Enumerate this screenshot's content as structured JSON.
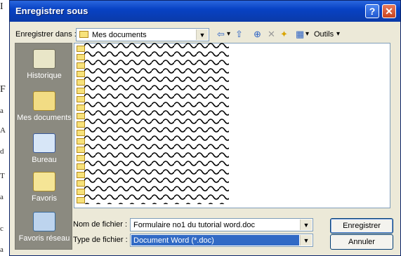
{
  "window": {
    "title": "Enregistrer sous",
    "help_glyph": "?",
    "close_glyph": "✕"
  },
  "lookin": {
    "label": "Enregistrer dans :",
    "value": "Mes documents",
    "arrow": "▼"
  },
  "toolbar": {
    "back": "⇦",
    "back_arrow": "▾",
    "up": "⇧",
    "search": "⊕",
    "delete": "✕",
    "new_folder": "✦",
    "views": "▦",
    "views_arrow": "▾",
    "tools_label": "Outils",
    "tools_arrow": "▾"
  },
  "places": [
    {
      "label": "Historique",
      "icon": "history-icon"
    },
    {
      "label": "Mes documents",
      "icon": "documents-folder-icon"
    },
    {
      "label": "Bureau",
      "icon": "desktop-icon"
    },
    {
      "label": "Favoris",
      "icon": "favorites-icon"
    },
    {
      "label": "Favoris réseau",
      "icon": "network-icon"
    }
  ],
  "files": [
    "",
    "",
    "",
    "",
    "",
    "",
    "",
    "",
    "",
    "",
    "",
    "",
    "",
    "",
    "",
    "",
    "",
    "",
    ""
  ],
  "filename": {
    "label": "Nom de fichier :",
    "value": "Formulaire no1 du tutorial word.doc"
  },
  "filetype": {
    "label": "Type de fichier :",
    "value": "Document Word (*.doc)"
  },
  "buttons": {
    "save": "Enregistrer",
    "cancel": "Annuler"
  },
  "background_letters": [
    "I",
    "F",
    "a",
    "A",
    "d",
    "T",
    "a",
    "c",
    "a"
  ],
  "colors": {
    "titlebar": "#0842c4",
    "dialog": "#ece9d8",
    "selection": "#316ac5"
  }
}
